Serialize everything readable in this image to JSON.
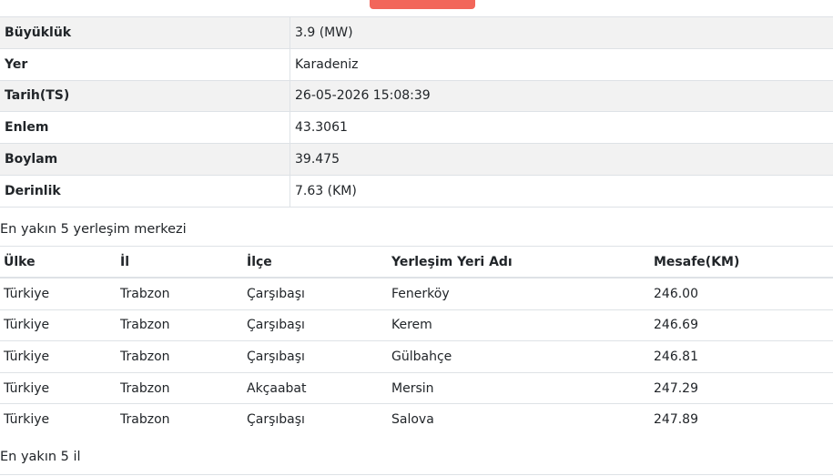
{
  "details": [
    {
      "key": "Büyüklük",
      "value": "3.9 (MW)"
    },
    {
      "key": "Yer",
      "value": "Karadeniz"
    },
    {
      "key": "Tarih(TS)",
      "value": "26-05-2026 15:08:39"
    },
    {
      "key": "Enlem",
      "value": "43.3061"
    },
    {
      "key": "Boylam",
      "value": "39.475"
    },
    {
      "key": "Derinlik",
      "value": "7.63 (KM)"
    }
  ],
  "nearby_settlements": {
    "title": "En yakın 5 yerleşim merkezi",
    "columns": [
      "Ülke",
      "İl",
      "İlçe",
      "Yerleşim Yeri Adı",
      "Mesafe(KM)"
    ],
    "rows": [
      [
        "Türkiye",
        "Trabzon",
        "Çarşıbaşı",
        "Fenerköy",
        "246.00"
      ],
      [
        "Türkiye",
        "Trabzon",
        "Çarşıbaşı",
        "Kerem",
        "246.69"
      ],
      [
        "Türkiye",
        "Trabzon",
        "Çarşıbaşı",
        "Gülbahçe",
        "246.81"
      ],
      [
        "Türkiye",
        "Trabzon",
        "Akçaabat",
        "Mersin",
        "247.29"
      ],
      [
        "Türkiye",
        "Trabzon",
        "Çarşıbaşı",
        "Salova",
        "247.89"
      ]
    ]
  },
  "nearby_provinces": {
    "title": "En yakın 5 il"
  }
}
